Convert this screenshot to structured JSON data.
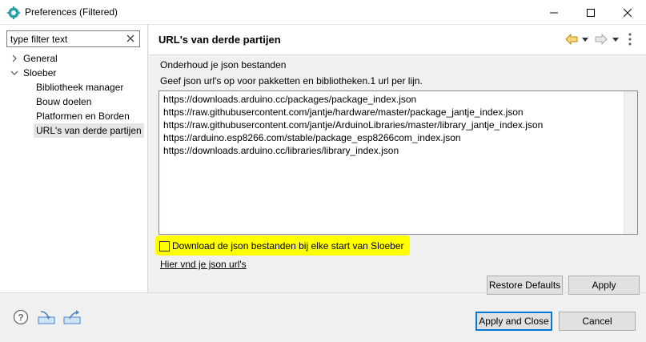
{
  "window": {
    "title": "Preferences (Filtered)",
    "icons": [
      "eclipse-gear-icon",
      "minimize-icon",
      "maximize-icon",
      "close-icon"
    ]
  },
  "sidebar": {
    "filter_value": "type filter text",
    "items": [
      {
        "label": "General",
        "expanded": false,
        "level": 0
      },
      {
        "label": "Sloeber",
        "expanded": true,
        "level": 0
      },
      {
        "label": "Bibliotheek manager",
        "level": 1
      },
      {
        "label": "Bouw doelen",
        "level": 1
      },
      {
        "label": "Platformen en Borden",
        "level": 1
      },
      {
        "label": "URL's van derde partijen",
        "level": 1,
        "selected": true
      }
    ]
  },
  "page": {
    "title": "URL's van derde partijen",
    "description": "Onderhoud je json bestanden",
    "instruction": "Geef json url's op voor pakketten en bibliotheken.1 url per lijn.",
    "urls": [
      "https://downloads.arduino.cc/packages/package_index.json",
      "https://raw.githubusercontent.com/jantje/hardware/master/package_jantje_index.json",
      "https://raw.githubusercontent.com/jantje/ArduinoLibraries/master/library_jantje_index.json",
      "https://arduino.esp8266.com/stable/package_esp8266com_index.json",
      "https://downloads.arduino.cc/libraries/library_index.json"
    ],
    "download_checkbox_label": "Download de json bestanden bij elke start van Sloeber",
    "download_checked": false,
    "highlight_color": "#ffff00",
    "link_text": "Hier vnd je json url's",
    "restore_defaults": "Restore Defaults",
    "apply": "Apply"
  },
  "footer": {
    "apply_and_close": "Apply and Close",
    "cancel": "Cancel",
    "icons": [
      "help-icon",
      "import-icon",
      "export-icon"
    ]
  }
}
